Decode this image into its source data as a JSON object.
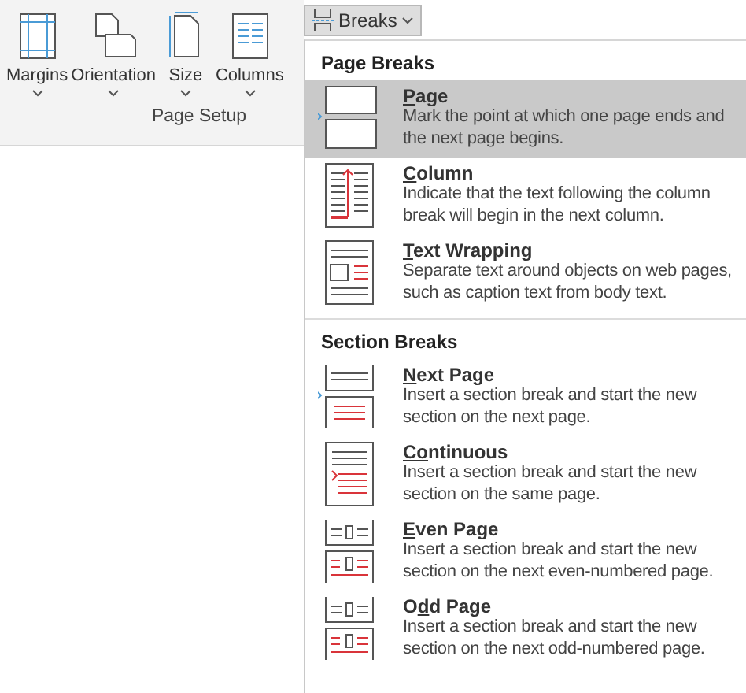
{
  "ribbon": {
    "buttons": [
      {
        "kind": "margins",
        "label": "Margins"
      },
      {
        "kind": "orientation",
        "label": "Orientation"
      },
      {
        "kind": "size",
        "label": "Size"
      },
      {
        "kind": "columns",
        "label": "Columns"
      }
    ],
    "group_label": "Page Setup"
  },
  "breaks_button": {
    "label": "Breaks",
    "expanded": true
  },
  "menu": {
    "sections": [
      {
        "heading": "Page Breaks",
        "items": [
          {
            "kind": "page",
            "title": {
              "key": "P",
              "rest": "age"
            },
            "description": "Mark the point at which one page ends and the next page begins.",
            "selected": true
          },
          {
            "kind": "column",
            "title": {
              "key": "C",
              "rest": "olumn"
            },
            "description": "Indicate that the text following the column break will begin in the next column.",
            "selected": false
          },
          {
            "kind": "wrap",
            "title": {
              "key": "T",
              "rest": "ext Wrapping"
            },
            "description": "Separate text around objects on web pages, such as caption text from body text.",
            "selected": false
          }
        ]
      },
      {
        "heading": "Section Breaks",
        "items": [
          {
            "kind": "next",
            "title": {
              "key": "N",
              "rest": "ext Page"
            },
            "description": "Insert a section break and start the new section on the next page.",
            "selected": false
          },
          {
            "kind": "continuous",
            "title": {
              "key": "Co",
              "rest": "ntinuous"
            },
            "description": "Insert a section break and start the new section on the same page.",
            "selected": false
          },
          {
            "kind": "even",
            "title": {
              "key": "E",
              "rest": "ven Page"
            },
            "description": "Insert a section break and start the new section on the next even-numbered page.",
            "selected": false
          },
          {
            "kind": "odd",
            "title": {
              "lead": "O",
              "key": "d",
              "rest": "d Page"
            },
            "description": "Insert a section break and start the new section on the next odd-numbered page.",
            "selected": false
          }
        ]
      }
    ]
  }
}
